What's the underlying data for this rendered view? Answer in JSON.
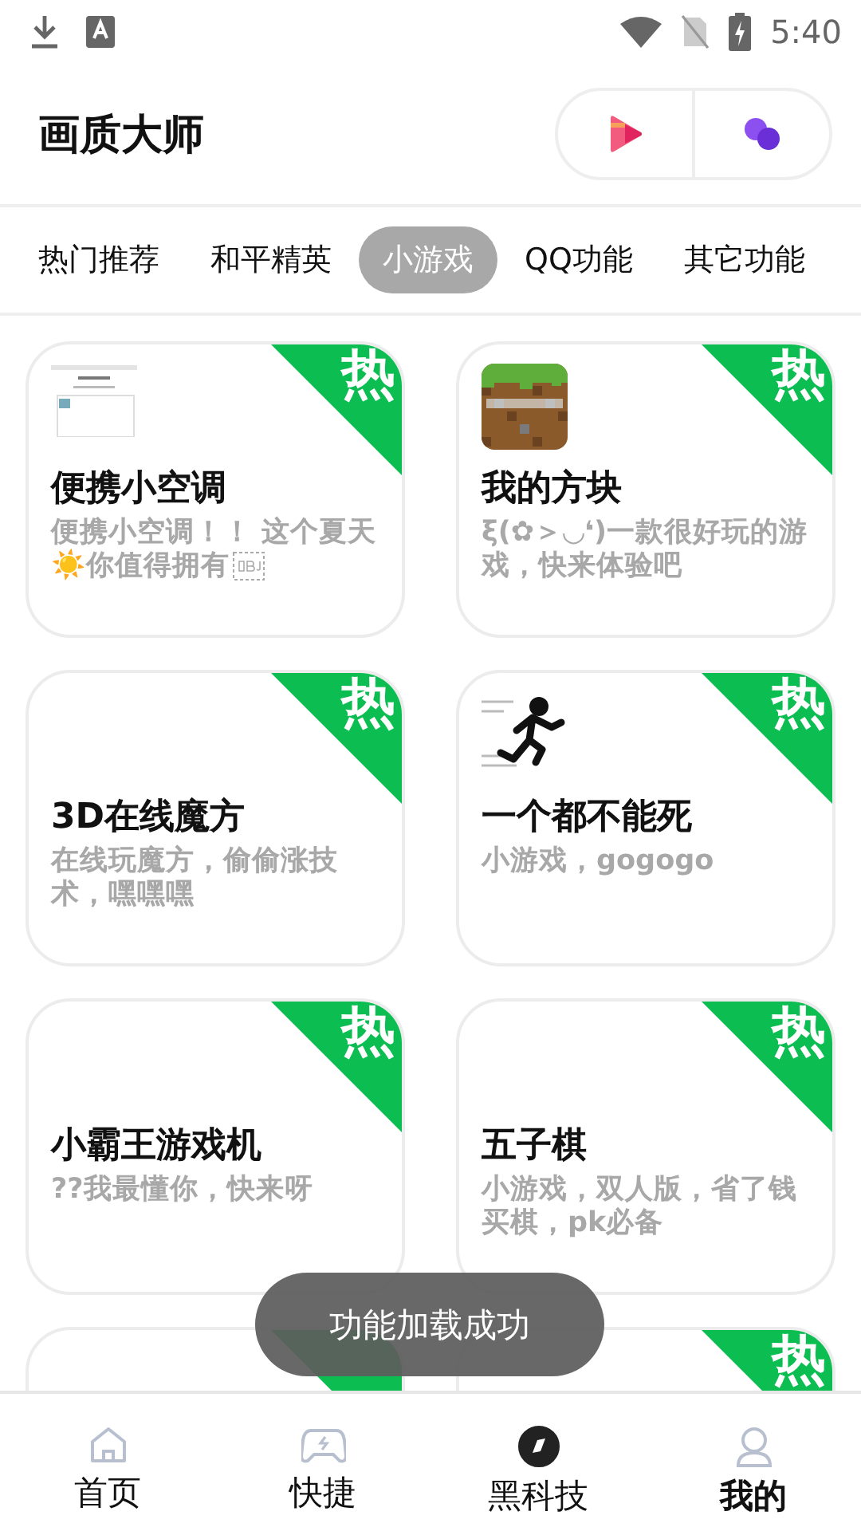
{
  "status_bar": {
    "time": "5:40"
  },
  "header": {
    "title": "画质大师"
  },
  "tabs": [
    {
      "label": "热门推荐",
      "selected": false
    },
    {
      "label": "和平精英",
      "selected": false
    },
    {
      "label": "小游戏",
      "selected": true
    },
    {
      "label": "QQ功能",
      "selected": false
    },
    {
      "label": "其它功能",
      "selected": false
    }
  ],
  "cards": [
    {
      "title": "便携小空调",
      "description": "便携小空调！！ 这个夏天☀️你值得拥有",
      "hot": true,
      "badge": "热"
    },
    {
      "title": "我的方块",
      "description": "ξ(✿＞◡❛)一款很好玩的游戏，快来体验吧",
      "hot": true,
      "badge": "热"
    },
    {
      "title": "3D在线魔方",
      "description": "在线玩魔方，偷偷涨技术，嘿嘿嘿",
      "hot": true,
      "badge": "热"
    },
    {
      "title": "一个都不能死",
      "description": "小游戏，gogogo",
      "hot": true,
      "badge": "热"
    },
    {
      "title": "小霸王游戏机",
      "description": "??我最懂你，快来呀",
      "hot": true,
      "badge": "热"
    },
    {
      "title": "五子棋",
      "description": "小游戏，双人版，省了钱买棋，pk必备",
      "hot": true,
      "badge": "热"
    },
    {
      "hot": true
    },
    {
      "hot": true,
      "badge": "热"
    }
  ],
  "toast": {
    "text": "功能加载成功"
  },
  "nav": {
    "items": [
      {
        "label": "首页",
        "selected": false,
        "bold": false
      },
      {
        "label": "快捷",
        "selected": false,
        "bold": false
      },
      {
        "label": "黑科技",
        "selected": true,
        "bold": false
      },
      {
        "label": "我的",
        "selected": false,
        "bold": true
      }
    ]
  }
}
